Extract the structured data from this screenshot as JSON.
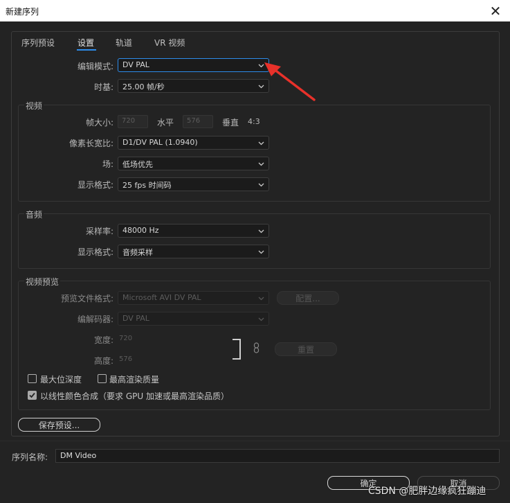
{
  "window": {
    "title": "新建序列",
    "close_glyph": "✕"
  },
  "tabs": [
    {
      "label": "序列预设",
      "active": false
    },
    {
      "label": "设置",
      "active": true
    },
    {
      "label": "轨道",
      "active": false
    },
    {
      "label": "VR 视频",
      "active": false
    }
  ],
  "general": {
    "edit_mode_label": "编辑模式:",
    "edit_mode_value": "DV PAL",
    "timebase_label": "时基:",
    "timebase_value": "25.00  帧/秒"
  },
  "video": {
    "section_title": "视频",
    "frame_size_label": "帧大小:",
    "frame_width": "720",
    "horizontal_label": "水平",
    "frame_height": "576",
    "vertical_label": "垂直",
    "aspect": "4:3",
    "pixel_aspect_label": "像素长宽比:",
    "pixel_aspect_value": "D1/DV PAL (1.0940)",
    "fields_label": "场:",
    "fields_value": "低场优先",
    "display_format_label": "显示格式:",
    "display_format_value": "25 fps 时间码"
  },
  "audio": {
    "section_title": "音频",
    "sample_rate_label": "采样率:",
    "sample_rate_value": "48000 Hz",
    "display_format_label": "显示格式:",
    "display_format_value": "音频采样"
  },
  "preview": {
    "section_title": "视频预览",
    "file_format_label": "预览文件格式:",
    "file_format_value": "Microsoft AVI DV PAL",
    "configure_button": "配置...",
    "codec_label": "编解码器:",
    "codec_value": "DV PAL",
    "width_label": "宽度:",
    "width_value": "720",
    "height_label": "高度:",
    "height_value": "576",
    "reset_button": "重置"
  },
  "options": {
    "max_bit_depth": {
      "label": "最大位深度",
      "checked": false
    },
    "max_render_quality": {
      "label": "最高渲染质量",
      "checked": false
    },
    "linear_color": {
      "label": "以线性颜色合成（要求 GPU 加速或最高渲染品质）",
      "checked": true
    }
  },
  "save_preset_button": "保存预设...",
  "sequence_name": {
    "label": "序列名称:",
    "value": "DM Video"
  },
  "footer": {
    "ok_button": "确定",
    "cancel_button": "取消"
  },
  "watermark": "CSDN @肥胖边缘疯狂蹦迪",
  "colors": {
    "accent": "#2d8ceb",
    "annotation_arrow": "#e8312a",
    "background": "#232323"
  }
}
